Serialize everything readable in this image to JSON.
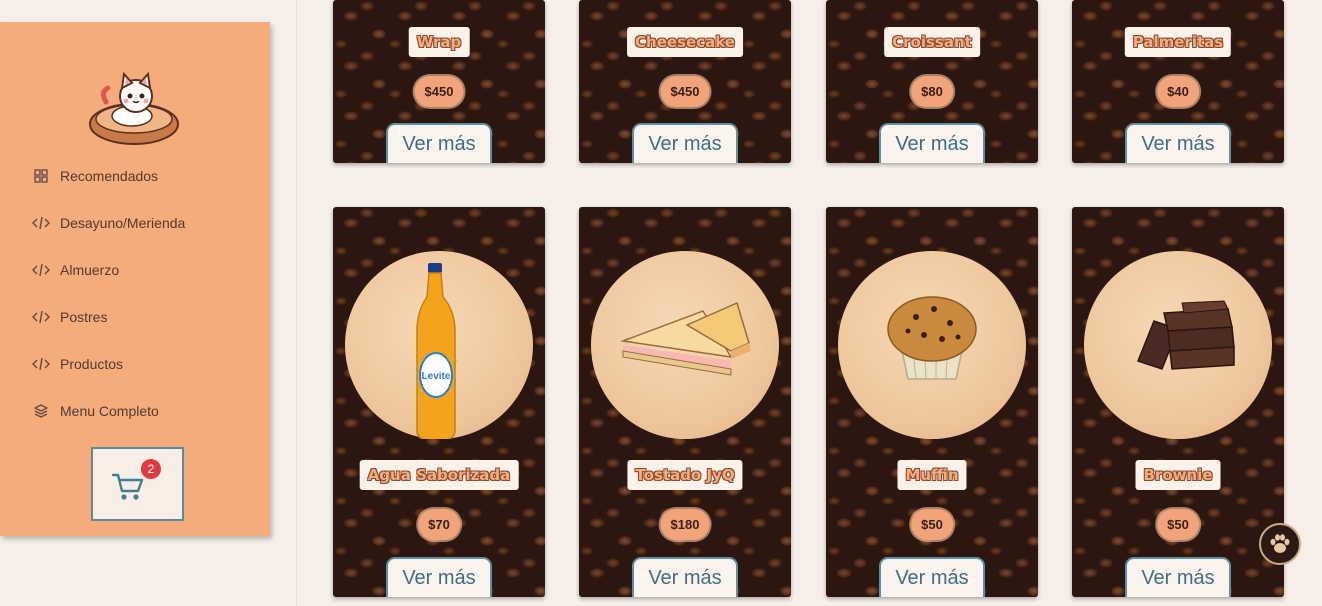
{
  "sidebar": {
    "items": [
      {
        "label": "Recomendados",
        "icon": "grid-icon"
      },
      {
        "label": "Desayuno/Merienda",
        "icon": "code-icon"
      },
      {
        "label": "Almuerzo",
        "icon": "code-icon"
      },
      {
        "label": "Postres",
        "icon": "code-icon"
      },
      {
        "label": "Productos",
        "icon": "code-icon"
      },
      {
        "label": "Menu Completo",
        "icon": "layers-icon"
      }
    ],
    "cart_count": "2"
  },
  "products_row1": [
    {
      "name": "Wrap",
      "price": "$450",
      "button": "Ver más"
    },
    {
      "name": "Cheesecake",
      "price": "$450",
      "button": "Ver más"
    },
    {
      "name": "Croissant",
      "price": "$80",
      "button": "Ver más"
    },
    {
      "name": "Palmeritas",
      "price": "$40",
      "button": "Ver más"
    }
  ],
  "products_row2": [
    {
      "name": "Agua Saborizada",
      "price": "$70",
      "button": "Ver más",
      "image": "bottle"
    },
    {
      "name": "Tostado JyQ",
      "price": "$180",
      "button": "Ver más",
      "image": "sandwich"
    },
    {
      "name": "Muffin",
      "price": "$50",
      "button": "Ver más",
      "image": "muffin"
    },
    {
      "name": "Brownie",
      "price": "$50",
      "button": "Ver más",
      "image": "brownie"
    }
  ],
  "colors": {
    "sidebar_bg": "#f6ab7a",
    "price_bg": "#f1a37a",
    "button_border": "#5d90a3",
    "badge": "#e03a3e"
  }
}
